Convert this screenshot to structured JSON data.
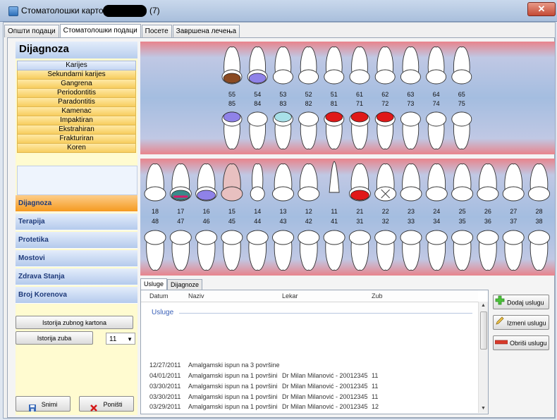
{
  "window": {
    "title": "Стоматолошки картон -",
    "title_suffix": "(7)",
    "close_label": "✕"
  },
  "tabs": [
    {
      "label": "Општи подаци",
      "active": false
    },
    {
      "label": "Стоматолошки подаци",
      "active": true
    },
    {
      "label": "Посете",
      "active": false
    },
    {
      "label": "Завршена лечења",
      "active": false
    }
  ],
  "sidebar": {
    "title": "Dijagnoza",
    "diagnoses": [
      "Karijes",
      "Sekundarni karijes",
      "Gangrena",
      "Periodontitis",
      "Paradontitis",
      "Kamenac",
      "Impaktiran",
      "Ekstrahiran",
      "Frakturiran",
      "Koren"
    ],
    "categories": [
      {
        "label": "Dijagnoza",
        "active": true
      },
      {
        "label": "Terapija",
        "active": false
      },
      {
        "label": "Protetika",
        "active": false
      },
      {
        "label": "Mostovi",
        "active": false
      },
      {
        "label": "Zdrava Stanja",
        "active": false
      },
      {
        "label": "Broj Korenova",
        "active": false
      }
    ],
    "history_card_button": "Istorija zubnog kartona",
    "tooth_history_button": "Istorija zuba",
    "tooth_select_value": "11",
    "save_button": "Snimi",
    "cancel_button": "Poništi"
  },
  "chart": {
    "primary_upper_numbers": [
      "55",
      "54",
      "53",
      "52",
      "51",
      "61",
      "62",
      "63",
      "64",
      "65"
    ],
    "primary_lower_numbers": [
      "85",
      "84",
      "83",
      "82",
      "81",
      "71",
      "72",
      "73",
      "74",
      "75"
    ],
    "permanent_upper_numbers": [
      "18",
      "17",
      "16",
      "15",
      "14",
      "13",
      "12",
      "11",
      "21",
      "22",
      "23",
      "24",
      "25",
      "26",
      "27",
      "28"
    ],
    "permanent_lower_numbers": [
      "48",
      "47",
      "46",
      "45",
      "44",
      "43",
      "42",
      "41",
      "31",
      "32",
      "33",
      "34",
      "35",
      "36",
      "37",
      "38"
    ],
    "marks": {
      "primary_upper": {
        "55": "brown",
        "54": "purple"
      },
      "primary_lower": {
        "85": "purple",
        "83": "cyan",
        "81": "red",
        "71": "red",
        "72": "red"
      },
      "permanent_upper": {
        "17": "multi",
        "16": "purple",
        "15": "extracted",
        "21": "red",
        "22": "fracture",
        "11": "root"
      }
    },
    "colors": {
      "red": "#e01818",
      "purple": "#8f82e8",
      "cyan": "#a8e0e8",
      "brown": "#8a4a22",
      "pink": "#e8c0c0"
    }
  },
  "bottom_tabs": [
    {
      "label": "Usluge",
      "active": true
    },
    {
      "label": "Dijagnoze",
      "active": false
    }
  ],
  "services_table": {
    "columns": [
      "Datum",
      "Naziv",
      "Lekar",
      "Zub"
    ],
    "group_label": "Usluge",
    "rows": [
      {
        "date": "12/27/2011",
        "name": "Amalgamski ispun na 3 površine",
        "doctor": "",
        "tooth": ""
      },
      {
        "date": "04/01/2011",
        "name": "Amalgamski ispun na 1 površini",
        "doctor": "Dr Milan Milanović - 20012345",
        "tooth": "11"
      },
      {
        "date": "03/30/2011",
        "name": "Amalgamski ispun na 1 površini",
        "doctor": "Dr Milan Milanović - 20012345",
        "tooth": "11"
      },
      {
        "date": "03/30/2011",
        "name": "Amalgamski ispun na 1 površini",
        "doctor": "Dr Milan Milanović - 20012345",
        "tooth": "11"
      },
      {
        "date": "03/29/2011",
        "name": "Amalgamski ispun na 1 površini",
        "doctor": "Dr Milan Milanović - 20012345",
        "tooth": "12"
      }
    ]
  },
  "actions": {
    "add_service": "Dodaj uslugu",
    "edit_service": "Izmeni uslugu",
    "delete_service": "Obriši uslugu"
  }
}
